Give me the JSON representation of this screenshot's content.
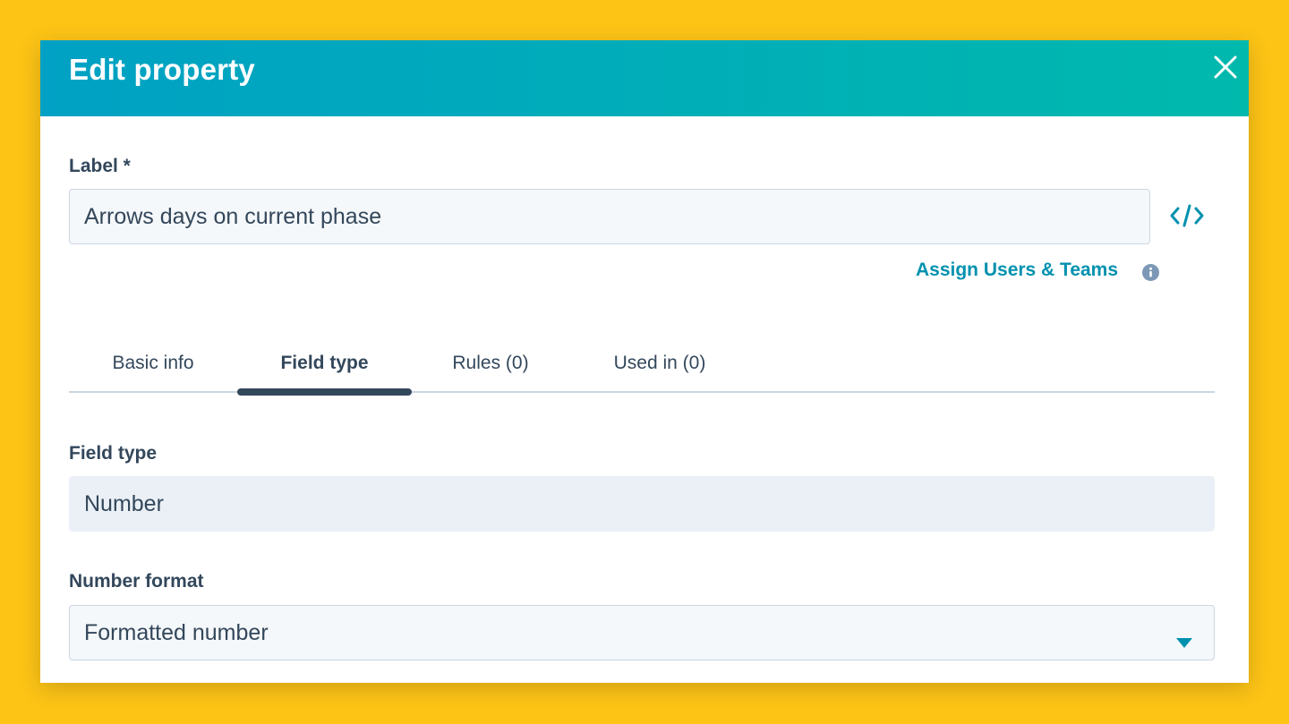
{
  "modal": {
    "title": "Edit property",
    "close_icon": "close-icon"
  },
  "label_field": {
    "label": "Label *",
    "value": "Arrows days on current phase",
    "code_icon": "code-icon"
  },
  "assign_link": {
    "text": "Assign Users & Teams",
    "info_icon": "info-icon"
  },
  "tabs": [
    {
      "label": "Basic info",
      "active": false
    },
    {
      "label": "Field type",
      "active": true
    },
    {
      "label": "Rules (0)",
      "active": false
    },
    {
      "label": "Used in (0)",
      "active": false
    }
  ],
  "field_type": {
    "label": "Field type",
    "value": "Number"
  },
  "number_format": {
    "label": "Number format",
    "value": "Formatted number",
    "caret_icon": "caret-down-icon"
  },
  "colors": {
    "background": "#FDC416",
    "header_start": "#00A1C4",
    "header_end": "#00B9AD",
    "accent": "#0091AE",
    "text": "#33475B"
  }
}
